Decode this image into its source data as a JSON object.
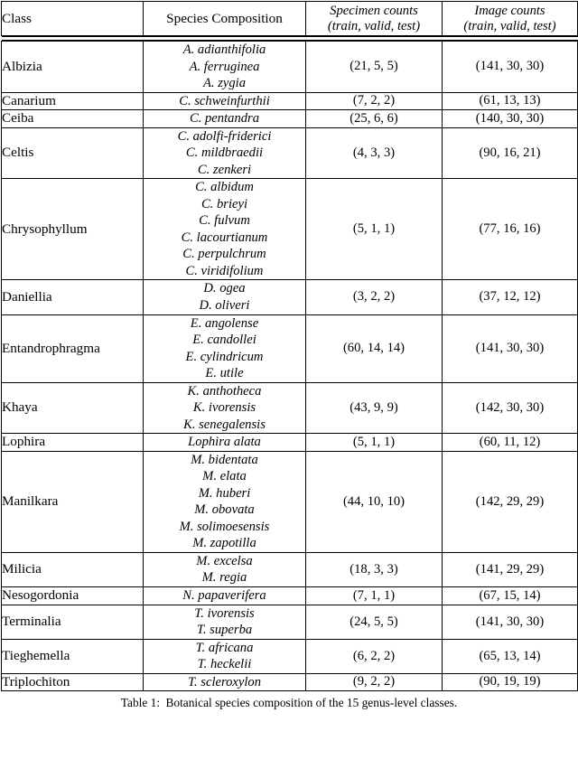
{
  "table": {
    "columns": [
      {
        "key": "class",
        "label": "Class",
        "style": "roman",
        "align": "left"
      },
      {
        "key": "species",
        "label": "Species Composition",
        "style": "roman",
        "align": "center"
      },
      {
        "key": "specimen",
        "label_line1": "Specimen counts",
        "label_line2": "(train, valid, test)",
        "style": "italic",
        "align": "center"
      },
      {
        "key": "image",
        "label_line1": "Image counts",
        "label_line2": "(train, valid, test)",
        "style": "italic",
        "align": "center"
      }
    ],
    "rows": [
      {
        "class": "Albizia",
        "species": [
          "A. adianthifolia",
          "A. ferruginea",
          "A. zygia"
        ],
        "specimen_counts": "(21, 5, 5)",
        "image_counts": "(141, 30, 30)"
      },
      {
        "class": "Canarium",
        "species": [
          "C. schweinfurthii"
        ],
        "specimen_counts": "(7, 2, 2)",
        "image_counts": "(61, 13, 13)"
      },
      {
        "class": "Ceiba",
        "species": [
          "C. pentandra"
        ],
        "specimen_counts": "(25, 6, 6)",
        "image_counts": "(140, 30, 30)"
      },
      {
        "class": "Celtis",
        "species": [
          "C. adolfi-friderici",
          "C. mildbraedii",
          "C. zenkeri"
        ],
        "specimen_counts": "(4, 3, 3)",
        "image_counts": "(90, 16, 21)"
      },
      {
        "class": "Chrysophyllum",
        "species": [
          "C. albidum",
          "C. brieyi",
          "C. fulvum",
          "C. lacourtianum",
          "C. perpulchrum",
          "C. viridifolium"
        ],
        "specimen_counts": "(5, 1, 1)",
        "image_counts": "(77, 16, 16)"
      },
      {
        "class": "Daniellia",
        "species": [
          "D. ogea",
          "D. oliveri"
        ],
        "specimen_counts": "(3, 2, 2)",
        "image_counts": "(37, 12, 12)"
      },
      {
        "class": "Entandrophragma",
        "species": [
          "E. angolense",
          "E. candollei",
          "E. cylindricum",
          "E. utile"
        ],
        "specimen_counts": "(60, 14, 14)",
        "image_counts": "(141, 30, 30)"
      },
      {
        "class": "Khaya",
        "species": [
          "K. anthotheca",
          "K. ivorensis",
          "K. senegalensis"
        ],
        "specimen_counts": "(43, 9, 9)",
        "image_counts": "(142, 30, 30)"
      },
      {
        "class": "Lophira",
        "species": [
          "Lophira alata"
        ],
        "specimen_counts": "(5, 1, 1)",
        "image_counts": "(60, 11, 12)"
      },
      {
        "class": "Manilkara",
        "species": [
          "M. bidentata",
          "M. elata",
          "M. huberi",
          "M. obovata",
          "M. solimoesensis",
          "M. zapotilla"
        ],
        "specimen_counts": "(44, 10, 10)",
        "image_counts": "(142, 29, 29)"
      },
      {
        "class": "Milicia",
        "species": [
          "M. excelsa",
          "M. regia"
        ],
        "specimen_counts": "(18, 3, 3)",
        "image_counts": "(141, 29, 29)"
      },
      {
        "class": "Nesogordonia",
        "species": [
          "N. papaverifera"
        ],
        "specimen_counts": "(7, 1, 1)",
        "image_counts": "(67, 15, 14)"
      },
      {
        "class": "Terminalia",
        "species": [
          "T. ivorensis",
          "T. superba"
        ],
        "specimen_counts": "(24, 5, 5)",
        "image_counts": "(141, 30, 30)"
      },
      {
        "class": "Tieghemella",
        "species": [
          "T. africana",
          "T. heckelii"
        ],
        "specimen_counts": "(6, 2, 2)",
        "image_counts": "(65, 13, 14)"
      },
      {
        "class": "Triplochiton",
        "species": [
          "T. scleroxylon"
        ],
        "specimen_counts": "(9, 2, 2)",
        "image_counts": "(90, 19, 19)"
      }
    ]
  },
  "caption": {
    "label": "Table 1:",
    "text": "Botanical species composition of the 15 genus-level classes."
  }
}
